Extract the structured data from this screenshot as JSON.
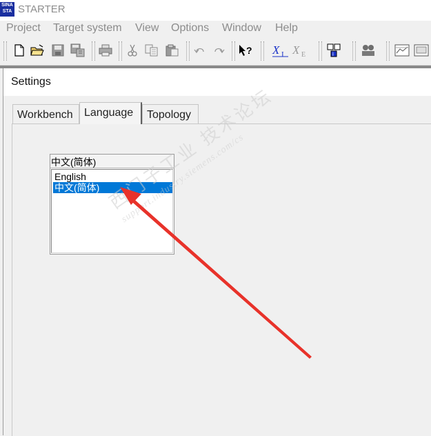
{
  "window": {
    "title": "STARTER",
    "icon_text": [
      "SINA",
      "STA"
    ]
  },
  "menubar": {
    "items": [
      "Project",
      "Target system",
      "View",
      "Options",
      "Window",
      "Help"
    ]
  },
  "toolbar": {
    "buttons": [
      "new-document-icon",
      "open-folder-icon",
      "save-icon",
      "save-compile-icon",
      "print-icon",
      "cut-icon",
      "copy-icon",
      "paste-icon",
      "undo-icon",
      "redo-icon",
      "help-pointer-icon",
      "xi-icon",
      "xe-icon",
      "accessible-nodes-icon",
      "devices-icon",
      "trace-icon",
      "screen-icon"
    ],
    "xi_label": "X",
    "xi_sub": "I",
    "xe_label": "X",
    "xe_sub": "E"
  },
  "dialog": {
    "title": "Settings",
    "tabs": [
      {
        "label": "Workbench",
        "active": false
      },
      {
        "label": "Language",
        "active": true
      },
      {
        "label": "Topology",
        "active": false
      }
    ],
    "language_list": {
      "current": "中文(简体)",
      "options": [
        "English",
        "中文(简体)"
      ],
      "selected": "中文(简体)"
    }
  },
  "watermark": {
    "line1": "西门子工业 技术论坛",
    "line2": "support.industry.siemens.com/cs"
  },
  "colors": {
    "selection": "#0078d7",
    "arrow": "#e8322a",
    "app_icon": "#1a2fa0"
  }
}
